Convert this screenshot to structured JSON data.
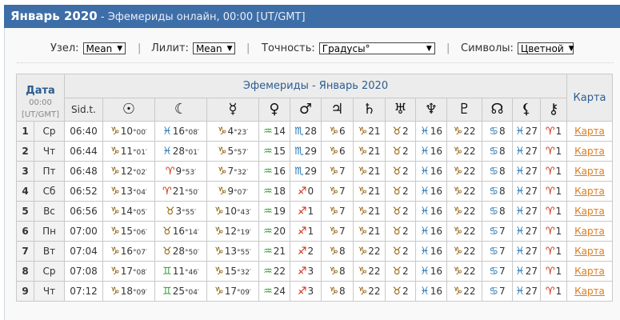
{
  "header": {
    "title": "Январь 2020",
    "subtitle": " - Эфемериды онлайн, 00:00 [UT/GMT]"
  },
  "controls": {
    "node": {
      "label": "Узел:",
      "value": "Mean"
    },
    "lilith": {
      "label": "Лилит:",
      "value": "Mean"
    },
    "precision": {
      "label": "Точность:",
      "value": "Градусы°"
    },
    "symbols": {
      "label": "Символы:",
      "value": "Цветной"
    },
    "separator": "|"
  },
  "table": {
    "date_title": "Дата",
    "date_time": "00:00",
    "date_tz": "[UT/GMT]",
    "main_title": "Эфемериды - Январь 2020",
    "karta_title": "Карта",
    "sid_label": "Sid.t.",
    "planets": [
      {
        "glyph": "☉",
        "icon": "sun-icon"
      },
      {
        "glyph": "☾",
        "icon": "moon-icon"
      },
      {
        "glyph": "☿",
        "icon": "mercury-icon"
      },
      {
        "glyph": "♀",
        "icon": "venus-icon"
      },
      {
        "glyph": "♂",
        "icon": "mars-icon"
      },
      {
        "glyph": "♃",
        "icon": "jupiter-icon"
      },
      {
        "glyph": "♄",
        "icon": "saturn-icon"
      },
      {
        "glyph": "♅",
        "icon": "uranus-icon"
      },
      {
        "glyph": "♆",
        "icon": "neptune-icon"
      },
      {
        "glyph": "♇",
        "icon": "pluto-icon"
      },
      {
        "glyph": "☊",
        "icon": "node-icon"
      },
      {
        "glyph": "⚸",
        "icon": "lilith-icon"
      },
      {
        "glyph": "⚷",
        "icon": "chiron-icon"
      }
    ],
    "rows": [
      {
        "n": "1",
        "dow": "Ср",
        "time": "06:40",
        "link": "Карта",
        "cells": [
          {
            "sign": "♑",
            "el": "earth",
            "deg": "10",
            "min": "00"
          },
          {
            "sign": "♓",
            "el": "water",
            "deg": "16",
            "min": "08"
          },
          {
            "sign": "♑",
            "el": "earth",
            "deg": "4",
            "min": "23"
          },
          {
            "sign": "♒",
            "el": "air",
            "deg": "14"
          },
          {
            "sign": "♏",
            "el": "water",
            "deg": "28"
          },
          {
            "sign": "♑",
            "el": "earth",
            "deg": "6"
          },
          {
            "sign": "♑",
            "el": "earth",
            "deg": "21"
          },
          {
            "sign": "♉",
            "el": "earth",
            "deg": "2"
          },
          {
            "sign": "♓",
            "el": "water",
            "deg": "16"
          },
          {
            "sign": "♑",
            "el": "earth",
            "deg": "22"
          },
          {
            "sign": "♋",
            "el": "water",
            "deg": "8"
          },
          {
            "sign": "♓",
            "el": "water",
            "deg": "27"
          },
          {
            "sign": "♈",
            "el": "fire",
            "deg": "1"
          }
        ]
      },
      {
        "n": "2",
        "dow": "Чт",
        "time": "06:44",
        "link": "Карта",
        "cells": [
          {
            "sign": "♑",
            "el": "earth",
            "deg": "11",
            "min": "01"
          },
          {
            "sign": "♓",
            "el": "water",
            "deg": "28",
            "min": "01"
          },
          {
            "sign": "♑",
            "el": "earth",
            "deg": "5",
            "min": "57"
          },
          {
            "sign": "♒",
            "el": "air",
            "deg": "15"
          },
          {
            "sign": "♏",
            "el": "water",
            "deg": "29"
          },
          {
            "sign": "♑",
            "el": "earth",
            "deg": "6"
          },
          {
            "sign": "♑",
            "el": "earth",
            "deg": "21"
          },
          {
            "sign": "♉",
            "el": "earth",
            "deg": "2"
          },
          {
            "sign": "♓",
            "el": "water",
            "deg": "16"
          },
          {
            "sign": "♑",
            "el": "earth",
            "deg": "22"
          },
          {
            "sign": "♋",
            "el": "water",
            "deg": "8"
          },
          {
            "sign": "♓",
            "el": "water",
            "deg": "27"
          },
          {
            "sign": "♈",
            "el": "fire",
            "deg": "1"
          }
        ]
      },
      {
        "n": "3",
        "dow": "Пт",
        "time": "06:48",
        "link": "Карта",
        "cells": [
          {
            "sign": "♑",
            "el": "earth",
            "deg": "12",
            "min": "02"
          },
          {
            "sign": "♈",
            "el": "fire",
            "deg": "9",
            "min": "53"
          },
          {
            "sign": "♑",
            "el": "earth",
            "deg": "7",
            "min": "32"
          },
          {
            "sign": "♒",
            "el": "air",
            "deg": "16"
          },
          {
            "sign": "♏",
            "el": "water",
            "deg": "29"
          },
          {
            "sign": "♑",
            "el": "earth",
            "deg": "7"
          },
          {
            "sign": "♑",
            "el": "earth",
            "deg": "21"
          },
          {
            "sign": "♉",
            "el": "earth",
            "deg": "2"
          },
          {
            "sign": "♓",
            "el": "water",
            "deg": "16"
          },
          {
            "sign": "♑",
            "el": "earth",
            "deg": "22"
          },
          {
            "sign": "♋",
            "el": "water",
            "deg": "8"
          },
          {
            "sign": "♓",
            "el": "water",
            "deg": "27"
          },
          {
            "sign": "♈",
            "el": "fire",
            "deg": "1"
          }
        ]
      },
      {
        "n": "4",
        "dow": "Сб",
        "time": "06:52",
        "link": "Карта",
        "cells": [
          {
            "sign": "♑",
            "el": "earth",
            "deg": "13",
            "min": "04"
          },
          {
            "sign": "♈",
            "el": "fire",
            "deg": "21",
            "min": "50"
          },
          {
            "sign": "♑",
            "el": "earth",
            "deg": "9",
            "min": "07"
          },
          {
            "sign": "♒",
            "el": "air",
            "deg": "18"
          },
          {
            "sign": "♐",
            "el": "fire",
            "deg": "0"
          },
          {
            "sign": "♑",
            "el": "earth",
            "deg": "7"
          },
          {
            "sign": "♑",
            "el": "earth",
            "deg": "21"
          },
          {
            "sign": "♉",
            "el": "earth",
            "deg": "2"
          },
          {
            "sign": "♓",
            "el": "water",
            "deg": "16"
          },
          {
            "sign": "♑",
            "el": "earth",
            "deg": "22"
          },
          {
            "sign": "♋",
            "el": "water",
            "deg": "8"
          },
          {
            "sign": "♓",
            "el": "water",
            "deg": "27"
          },
          {
            "sign": "♈",
            "el": "fire",
            "deg": "1"
          }
        ]
      },
      {
        "n": "5",
        "dow": "Вс",
        "time": "06:56",
        "link": "Карта",
        "cells": [
          {
            "sign": "♑",
            "el": "earth",
            "deg": "14",
            "min": "05"
          },
          {
            "sign": "♉",
            "el": "earth",
            "deg": "3",
            "min": "55"
          },
          {
            "sign": "♑",
            "el": "earth",
            "deg": "10",
            "min": "43"
          },
          {
            "sign": "♒",
            "el": "air",
            "deg": "19"
          },
          {
            "sign": "♐",
            "el": "fire",
            "deg": "1"
          },
          {
            "sign": "♑",
            "el": "earth",
            "deg": "7"
          },
          {
            "sign": "♑",
            "el": "earth",
            "deg": "21"
          },
          {
            "sign": "♉",
            "el": "earth",
            "deg": "2"
          },
          {
            "sign": "♓",
            "el": "water",
            "deg": "16"
          },
          {
            "sign": "♑",
            "el": "earth",
            "deg": "22"
          },
          {
            "sign": "♋",
            "el": "water",
            "deg": "8"
          },
          {
            "sign": "♓",
            "el": "water",
            "deg": "27"
          },
          {
            "sign": "♈",
            "el": "fire",
            "deg": "1"
          }
        ]
      },
      {
        "n": "6",
        "dow": "Пн",
        "time": "07:00",
        "link": "Карта",
        "cells": [
          {
            "sign": "♑",
            "el": "earth",
            "deg": "15",
            "min": "06"
          },
          {
            "sign": "♉",
            "el": "earth",
            "deg": "16",
            "min": "14"
          },
          {
            "sign": "♑",
            "el": "earth",
            "deg": "12",
            "min": "19"
          },
          {
            "sign": "♒",
            "el": "air",
            "deg": "20"
          },
          {
            "sign": "♐",
            "el": "fire",
            "deg": "1"
          },
          {
            "sign": "♑",
            "el": "earth",
            "deg": "7"
          },
          {
            "sign": "♑",
            "el": "earth",
            "deg": "21"
          },
          {
            "sign": "♉",
            "el": "earth",
            "deg": "2"
          },
          {
            "sign": "♓",
            "el": "water",
            "deg": "16"
          },
          {
            "sign": "♑",
            "el": "earth",
            "deg": "22"
          },
          {
            "sign": "♋",
            "el": "water",
            "deg": "7"
          },
          {
            "sign": "♓",
            "el": "water",
            "deg": "27"
          },
          {
            "sign": "♈",
            "el": "fire",
            "deg": "1"
          }
        ]
      },
      {
        "n": "7",
        "dow": "Вт",
        "time": "07:04",
        "link": "Карта",
        "cells": [
          {
            "sign": "♑",
            "el": "earth",
            "deg": "16",
            "min": "07"
          },
          {
            "sign": "♉",
            "el": "earth",
            "deg": "28",
            "min": "50"
          },
          {
            "sign": "♑",
            "el": "earth",
            "deg": "13",
            "min": "55"
          },
          {
            "sign": "♒",
            "el": "air",
            "deg": "21"
          },
          {
            "sign": "♐",
            "el": "fire",
            "deg": "2"
          },
          {
            "sign": "♑",
            "el": "earth",
            "deg": "8"
          },
          {
            "sign": "♑",
            "el": "earth",
            "deg": "22"
          },
          {
            "sign": "♉",
            "el": "earth",
            "deg": "2"
          },
          {
            "sign": "♓",
            "el": "water",
            "deg": "16"
          },
          {
            "sign": "♑",
            "el": "earth",
            "deg": "22"
          },
          {
            "sign": "♋",
            "el": "water",
            "deg": "7"
          },
          {
            "sign": "♓",
            "el": "water",
            "deg": "27"
          },
          {
            "sign": "♈",
            "el": "fire",
            "deg": "1"
          }
        ]
      },
      {
        "n": "8",
        "dow": "Ср",
        "time": "07:08",
        "link": "Карта",
        "cells": [
          {
            "sign": "♑",
            "el": "earth",
            "deg": "17",
            "min": "08"
          },
          {
            "sign": "♊",
            "el": "air",
            "deg": "11",
            "min": "46"
          },
          {
            "sign": "♑",
            "el": "earth",
            "deg": "15",
            "min": "32"
          },
          {
            "sign": "♒",
            "el": "air",
            "deg": "22"
          },
          {
            "sign": "♐",
            "el": "fire",
            "deg": "3"
          },
          {
            "sign": "♑",
            "el": "earth",
            "deg": "8"
          },
          {
            "sign": "♑",
            "el": "earth",
            "deg": "22"
          },
          {
            "sign": "♉",
            "el": "earth",
            "deg": "2"
          },
          {
            "sign": "♓",
            "el": "water",
            "deg": "16"
          },
          {
            "sign": "♑",
            "el": "earth",
            "deg": "22"
          },
          {
            "sign": "♋",
            "el": "water",
            "deg": "7"
          },
          {
            "sign": "♓",
            "el": "water",
            "deg": "27"
          },
          {
            "sign": "♈",
            "el": "fire",
            "deg": "1"
          }
        ]
      },
      {
        "n": "9",
        "dow": "Чт",
        "time": "07:12",
        "link": "Карта",
        "cells": [
          {
            "sign": "♑",
            "el": "earth",
            "deg": "18",
            "min": "09"
          },
          {
            "sign": "♊",
            "el": "air",
            "deg": "25",
            "min": "04"
          },
          {
            "sign": "♑",
            "el": "earth",
            "deg": "17",
            "min": "09"
          },
          {
            "sign": "♒",
            "el": "air",
            "deg": "24"
          },
          {
            "sign": "♐",
            "el": "fire",
            "deg": "3"
          },
          {
            "sign": "♑",
            "el": "earth",
            "deg": "8"
          },
          {
            "sign": "♑",
            "el": "earth",
            "deg": "22"
          },
          {
            "sign": "♉",
            "el": "earth",
            "deg": "2"
          },
          {
            "sign": "♓",
            "el": "water",
            "deg": "16"
          },
          {
            "sign": "♑",
            "el": "earth",
            "deg": "22"
          },
          {
            "sign": "♋",
            "el": "water",
            "deg": "7"
          },
          {
            "sign": "♓",
            "el": "water",
            "deg": "27"
          },
          {
            "sign": "♈",
            "el": "fire",
            "deg": "1"
          }
        ]
      }
    ]
  }
}
